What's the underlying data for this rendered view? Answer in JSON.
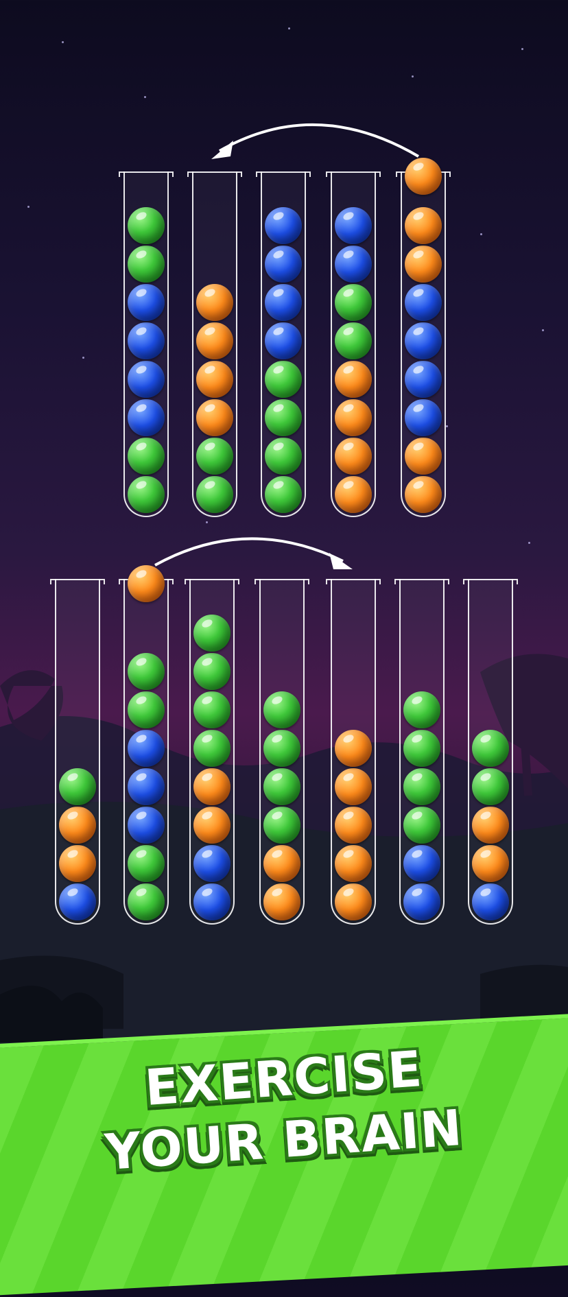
{
  "banner": {
    "line1": "EXERCISE",
    "line2": "YOUR BRAIN"
  },
  "colors": {
    "green": "#3fc93a",
    "blue": "#1d4fe8",
    "orange": "#ff8a1a",
    "banner_green": "#5ad62c"
  },
  "puzzle_top": {
    "tubes": [
      [
        "green",
        "green",
        "blue",
        "blue",
        "blue",
        "blue",
        "green",
        "green"
      ],
      [
        "green",
        "green",
        "orange",
        "orange",
        "orange",
        "orange"
      ],
      [
        "green",
        "green",
        "green",
        "green",
        "blue",
        "blue",
        "blue",
        "blue"
      ],
      [
        "orange",
        "orange",
        "orange",
        "orange",
        "green",
        "green",
        "blue",
        "blue"
      ],
      [
        "orange",
        "orange",
        "blue",
        "blue",
        "blue",
        "blue",
        "orange",
        "orange"
      ]
    ],
    "lifted_ball": {
      "color": "orange",
      "tube": 4
    },
    "move_arrow": {
      "from_tube": 4,
      "to_tube": 1,
      "direction": "left"
    }
  },
  "puzzle_bottom": {
    "tubes": [
      [
        "blue",
        "orange",
        "orange",
        "green"
      ],
      [
        "green",
        "green",
        "blue",
        "blue",
        "blue",
        "green",
        "green"
      ],
      [
        "blue",
        "blue",
        "orange",
        "orange",
        "green",
        "green",
        "green",
        "green"
      ],
      [
        "orange",
        "orange",
        "green",
        "green",
        "green",
        "green"
      ],
      [
        "orange",
        "orange",
        "orange",
        "orange",
        "orange"
      ],
      [
        "blue",
        "blue",
        "green",
        "green",
        "green",
        "green"
      ],
      [
        "blue",
        "orange",
        "orange",
        "green",
        "green"
      ]
    ],
    "lifted_ball": {
      "color": "orange",
      "tube": 1
    },
    "move_arrow": {
      "from_tube": 1,
      "to_tube": 4,
      "direction": "right"
    }
  }
}
